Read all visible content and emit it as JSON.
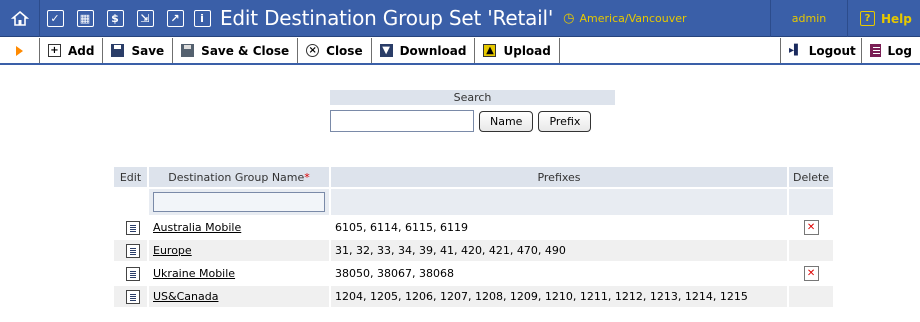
{
  "header": {
    "title": "Edit Destination Group Set 'Retail'",
    "timezone": "America/Vancouver",
    "user": "admin",
    "help_label": "Help",
    "icons": [
      "home-icon",
      "checkbox-icon",
      "grid-icon",
      "dollar-icon",
      "book-icon",
      "chart-icon",
      "info-icon"
    ],
    "colors": {
      "bar": "#3a5fa8",
      "accent": "#e6c800"
    }
  },
  "toolbar": {
    "add": "Add",
    "save": "Save",
    "save_close": "Save & Close",
    "close": "Close",
    "download": "Download",
    "upload": "Upload",
    "logout": "Logout",
    "log": "Log"
  },
  "search": {
    "heading": "Search",
    "value": "",
    "name_button": "Name",
    "prefix_button": "Prefix"
  },
  "table": {
    "headers": {
      "edit": "Edit",
      "name": "Destination Group Name",
      "name_required": "*",
      "prefixes": "Prefixes",
      "delete": "Delete"
    },
    "filter_value": "",
    "rows": [
      {
        "name": "Australia Mobile",
        "prefixes": "6105, 6114, 6115, 6119",
        "deletable": true
      },
      {
        "name": "Europe",
        "prefixes": "31, 32, 33, 34, 39, 41, 420, 421, 470, 490",
        "deletable": false
      },
      {
        "name": "Ukraine Mobile",
        "prefixes": "38050, 38067, 38068",
        "deletable": true
      },
      {
        "name": "US&Canada",
        "prefixes": "1204, 1205, 1206, 1207, 1208, 1209, 1210, 1211, 1212, 1213, 1214, 1215",
        "deletable": false
      }
    ]
  }
}
